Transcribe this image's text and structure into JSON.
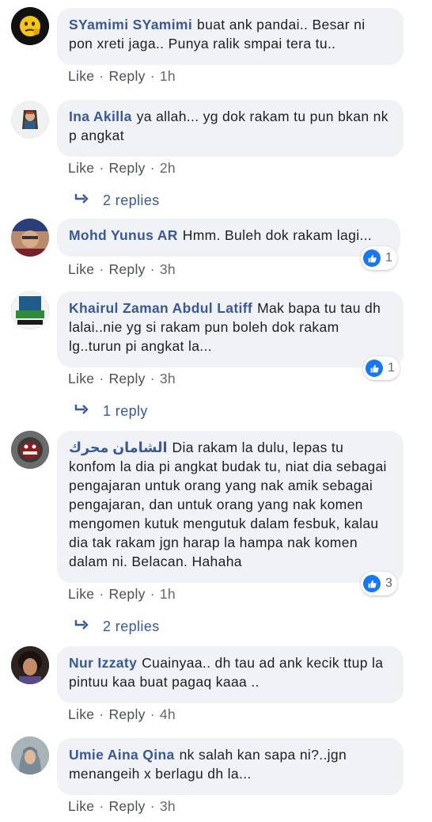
{
  "actions": {
    "like": "Like",
    "reply": "Reply",
    "sep": "·"
  },
  "colors": {
    "author": "#385898",
    "bubble": "#f0f2f5",
    "like_blue": "#1877f2",
    "meta": "#65676b"
  },
  "comments": [
    {
      "author": "SYamimi SYamimi",
      "text": "buat ank pandai.. Besar ni pon xreti jaga.. Punya ralik smpai tera tu..",
      "time": "1h",
      "avatar_icon": "emoji-avatar"
    },
    {
      "author": "Ina Akilla",
      "text": "ya allah... yg dok rakam tu pun bkan nk p angkat",
      "time": "2h",
      "replies": "2 replies",
      "avatar_icon": "avatar"
    },
    {
      "author": "Mohd Yunus AR",
      "text": "Hmm. Buleh dok rakam lagi...",
      "time": "3h",
      "reaction_count": "1",
      "avatar_icon": "avatar"
    },
    {
      "author": "Khairul Zaman Abdul Latiff",
      "text": "Mak bapa tu tau dh lalai..nie yg si rakam pun boleh dok rakam lg..turun pi angkat la...",
      "time": "3h",
      "reaction_count": "1",
      "replies": "1 reply",
      "avatar_icon": "avatar"
    },
    {
      "author": "الشامان محرك",
      "text": "Dia rakam la dulu, lepas tu konfom la dia pi angkat budak tu, niat dia sebagai pengajaran untuk orang yang nak amik sebagai pengajaran, dan untuk orang yang nak komen mengomen kutuk mengutuk dalam fesbuk, kalau dia tak rakam jgn harap la hampa nak komen dalam ni. Belacan. Hahaha",
      "time": "1h",
      "reaction_count": "3",
      "replies": "2 replies",
      "avatar_icon": "avatar"
    },
    {
      "author": "Nur Izzaty",
      "text": "Cuainyaa.. dh tau ad ank kecik ttup la pintuu kaa buat pagaq kaaa ..",
      "time": "4h",
      "avatar_icon": "avatar"
    },
    {
      "author": "Umie Aina Qina",
      "text": "nk salah kan sapa ni?..jgn menangeih x berlagu dh la...",
      "time": "3h",
      "avatar_icon": "avatar"
    }
  ]
}
